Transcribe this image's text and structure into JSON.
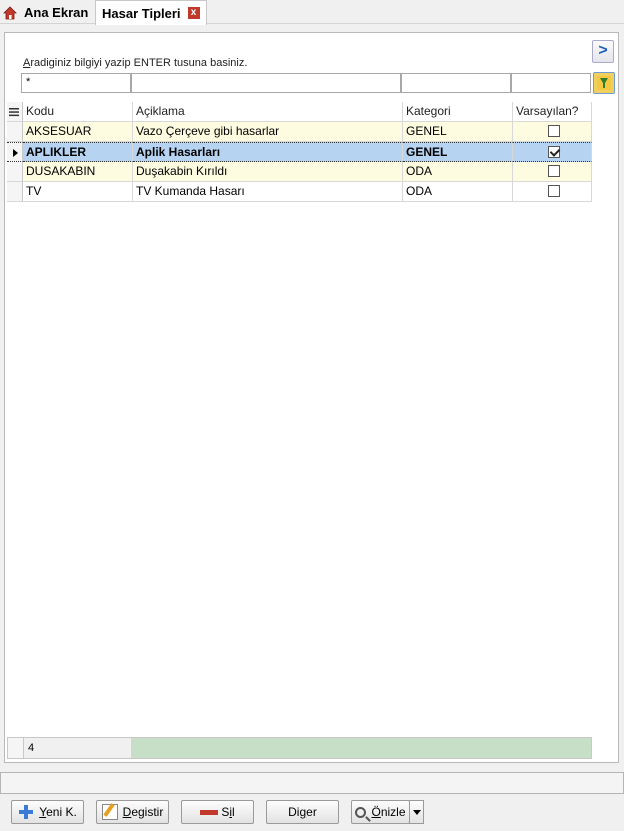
{
  "tabs": [
    {
      "label": "Ana Ekran",
      "icon": "home-icon"
    },
    {
      "label": "Hasar Tipleri",
      "close_icon": "close-icon",
      "close_label": "x"
    }
  ],
  "search": {
    "hint_underlined": "A",
    "hint_rest": "radiginiz bilgiyi yazip ENTER tusuna basiniz.",
    "filter_values": [
      "*",
      "",
      "",
      "",
      ""
    ],
    "nav_label": ">"
  },
  "grid": {
    "columns": [
      "Kodu",
      "Açiklama",
      "Kategori",
      "Varsayılan?"
    ],
    "rows": [
      {
        "kodu": "AKSESUAR",
        "aciklama": "Vazo Çerçeve gibi hasarlar",
        "kategori": "GENEL",
        "varsayilan": false
      },
      {
        "kodu": "APLIKLER",
        "aciklama": "Aplik Hasarları",
        "kategori": "GENEL",
        "varsayilan": true,
        "selected": true
      },
      {
        "kodu": "DUSAKABIN",
        "aciklama": "Duşakabin Kırıldı",
        "kategori": "ODA",
        "varsayilan": false
      },
      {
        "kodu": "TV",
        "aciklama": "TV Kumanda Hasarı",
        "kategori": "ODA",
        "varsayilan": false
      }
    ],
    "record_count": "4"
  },
  "toolbar": {
    "new_ul": "Y",
    "new_rest": "eni K.",
    "edit_ul": "D",
    "edit_rest": "egistir",
    "delete_pre": "S",
    "delete_ul": "i",
    "delete_rest": "l",
    "other_pre": "Di",
    "other_ul": "g",
    "other_rest": "er",
    "preview_ul": "Ö",
    "preview_rest": "nizle"
  },
  "colors": {
    "selected_row": "#b6d3f2",
    "alt_row": "#fdfbe0",
    "footer_green": "#c6dfc6"
  }
}
